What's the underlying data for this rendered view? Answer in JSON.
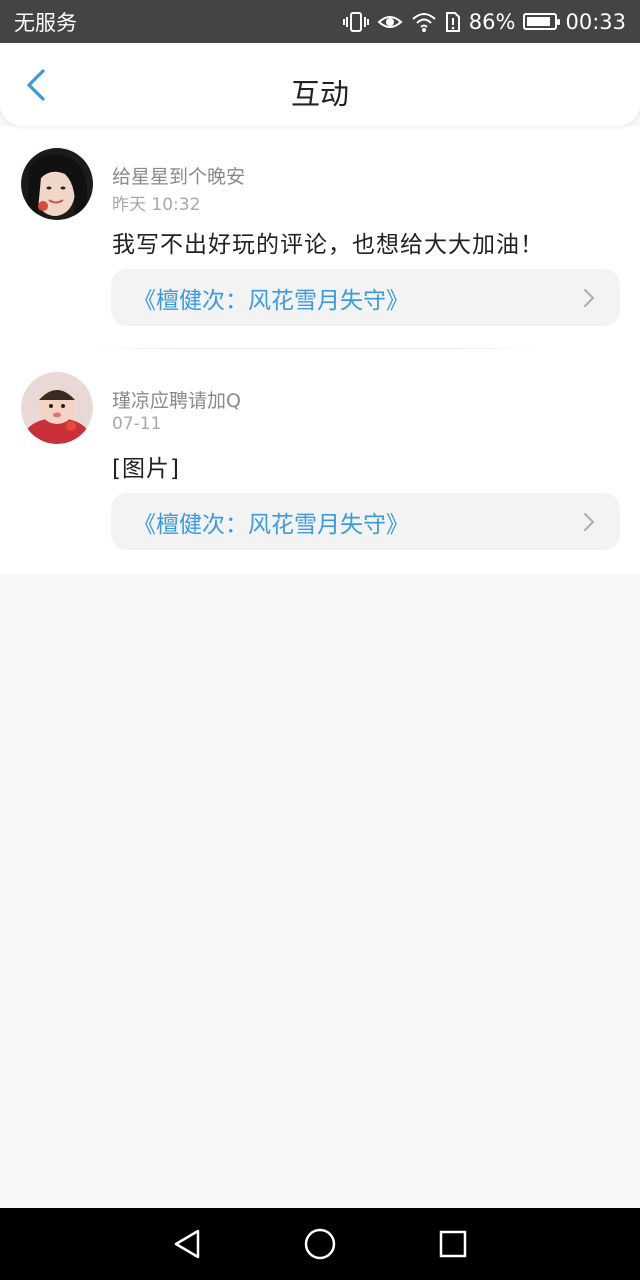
{
  "status_bar": {
    "carrier": "无服务",
    "battery": "86%",
    "battery_level": 0.86,
    "time": "00:33",
    "icons": [
      "vibrate-icon",
      "eye-icon",
      "wifi-icon",
      "sim-icon",
      "battery-icon"
    ]
  },
  "header": {
    "title": "互动",
    "back_icon": "back-chevron-icon"
  },
  "colors": {
    "accent": "#3a9be0",
    "header_bg": "#ffffff",
    "page_bg": "#f8f6f7",
    "nav_bg": "#000000"
  },
  "interactions": [
    {
      "username": "给星星到个晚安",
      "time": "昨天 10:32",
      "comment": "我写不出好玩的评论，也想给大大加油！",
      "book_title": "《檀健次：风花雪月失守》"
    },
    {
      "username": "瑾凉应聘请加Q",
      "time": "07-11",
      "comment": "[图片]",
      "book_title": "《檀健次：风花雪月失守》"
    }
  ],
  "nav_bar": {
    "items": [
      "back-triangle-icon",
      "home-circle-icon",
      "recents-square-icon"
    ]
  }
}
